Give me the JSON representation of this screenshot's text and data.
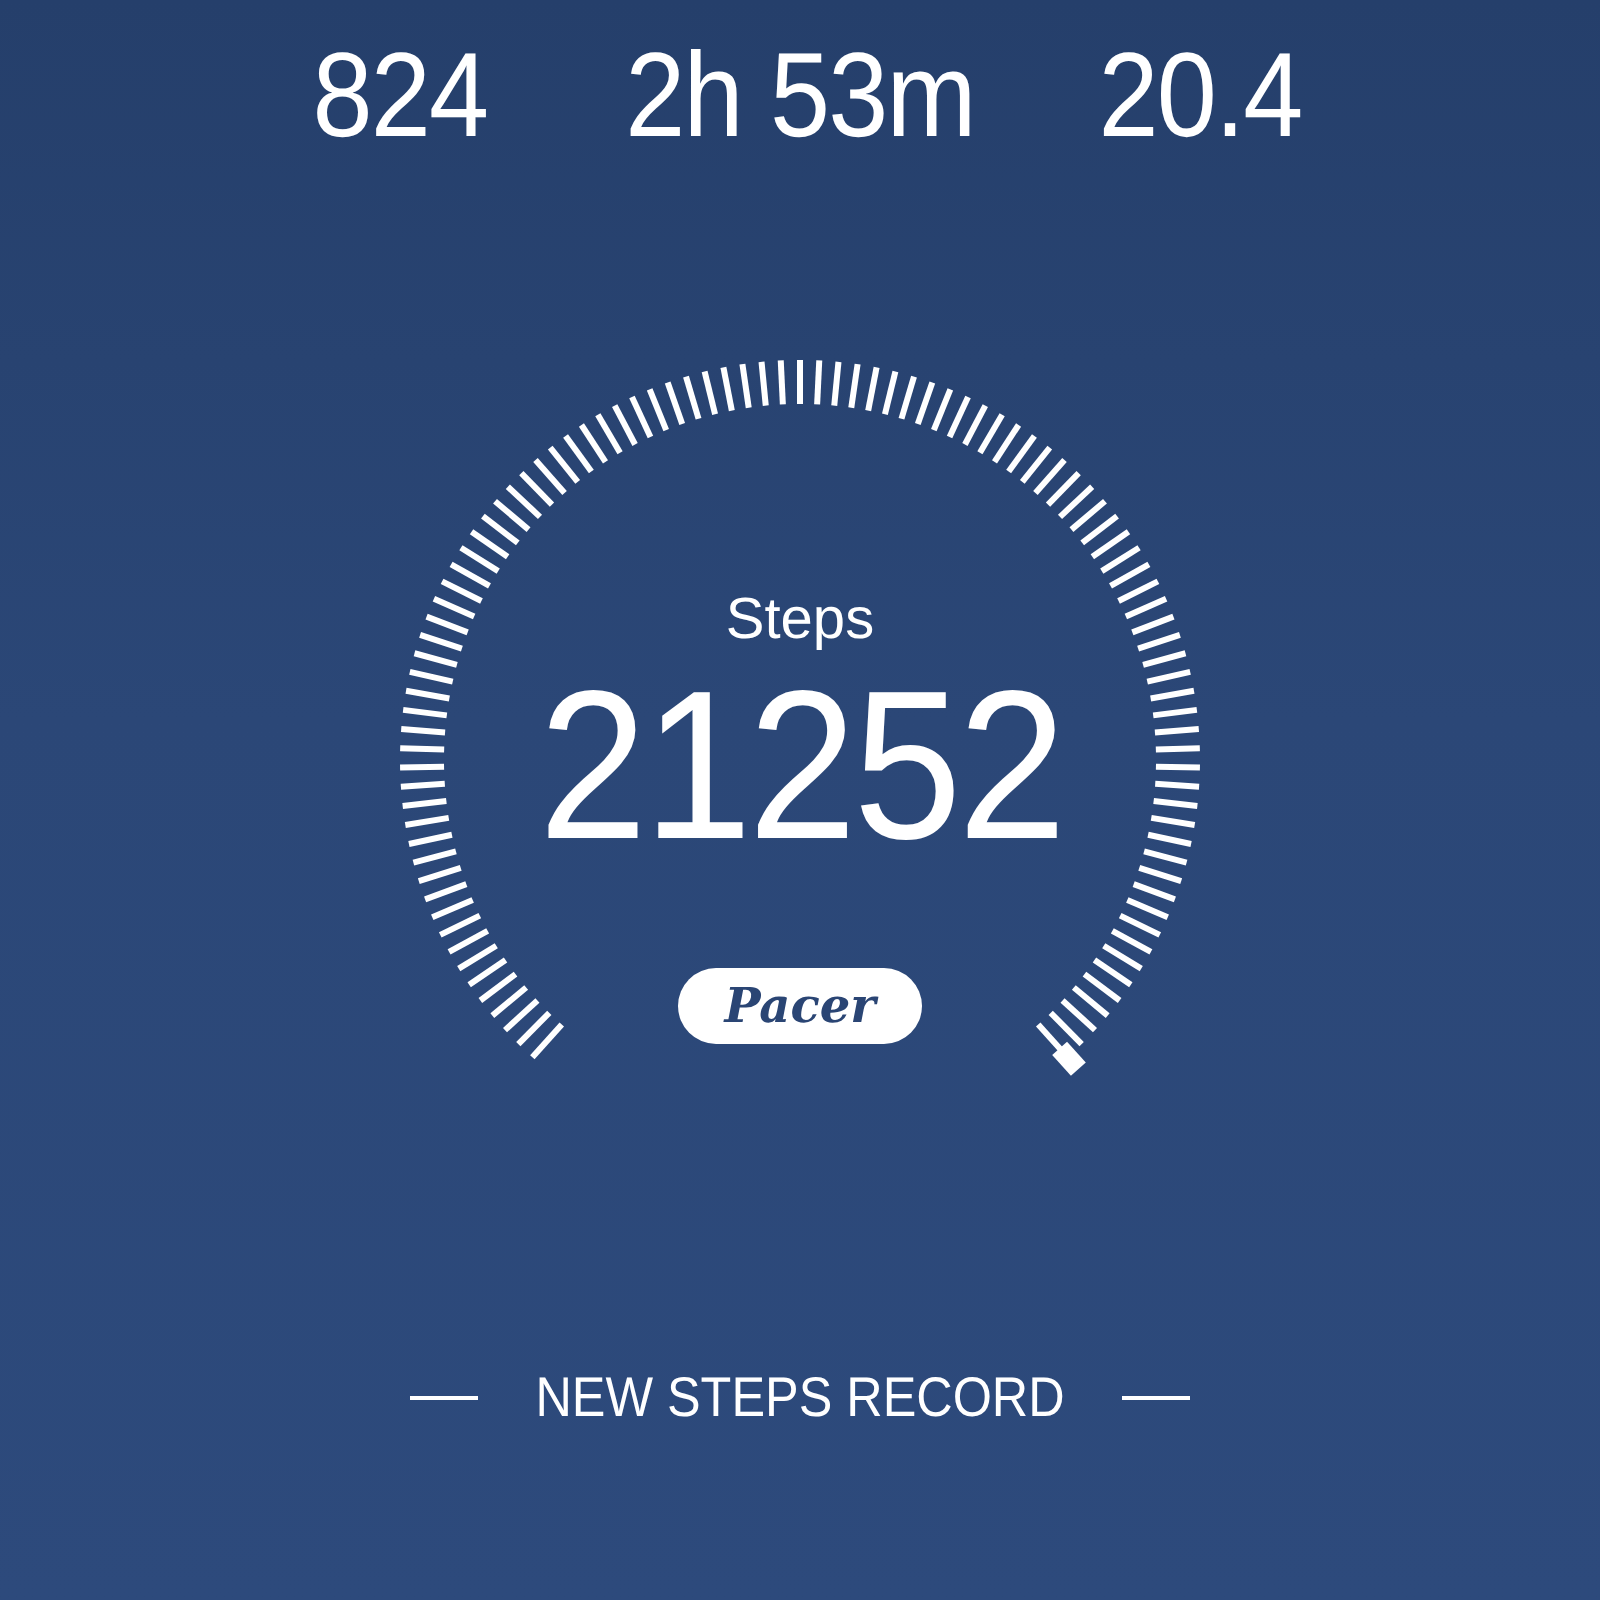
{
  "stats": [
    {
      "value": "824"
    },
    {
      "value": "2h 53m"
    },
    {
      "value": "20.4"
    }
  ],
  "gauge": {
    "label": "Steps",
    "value": "21252"
  },
  "logo": "Pacer",
  "record_banner": "NEW STEPS RECORD"
}
